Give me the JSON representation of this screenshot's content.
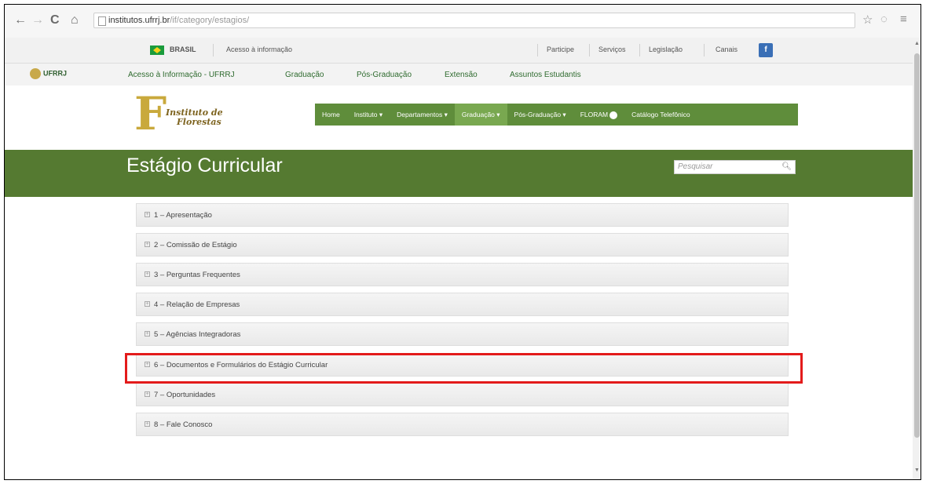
{
  "browser": {
    "url_host": "institutos.ufrrj.br",
    "url_path": "/if/category/estagios/"
  },
  "govbar": {
    "country": "BRASIL",
    "access": "Acesso à informação",
    "links": [
      "Participe",
      "Serviços",
      "Legislação",
      "Canais"
    ]
  },
  "ufrrj": {
    "logo_text": "UFRRJ",
    "links": [
      "Acesso à Informação - UFRRJ",
      "Graduação",
      "Pós-Graduação",
      "Extensão",
      "Assuntos Estudantis"
    ]
  },
  "institute": {
    "logo_letter": "F",
    "logo_name_1": "Instituto de",
    "logo_name_2": "Florestas"
  },
  "mainnav": {
    "items": [
      "Home",
      "Instituto ▾",
      "Departamentos ▾",
      "Graduação ▾",
      "Pós-Graduação ▾",
      "FLORAM",
      "Catálogo Telefônico"
    ],
    "active_index": 3
  },
  "banner": {
    "title": "Estágio Curricular",
    "search_placeholder": "Pesquisar"
  },
  "accordion": {
    "items": [
      "1 – Apresentação",
      "2 – Comissão de Estágio",
      "3 – Perguntas Frequentes",
      "4 – Relação de Empresas",
      "5 – Agências Integradoras",
      "6 – Documentos e Formulários do Estágio Curricular",
      "7 – Oportunidades",
      "8 – Fale Conosco"
    ],
    "highlighted_index": 5
  },
  "colors": {
    "green_dark": "#557a31",
    "green_nav": "#5f8d3b",
    "highlight": "#e31b1b"
  }
}
